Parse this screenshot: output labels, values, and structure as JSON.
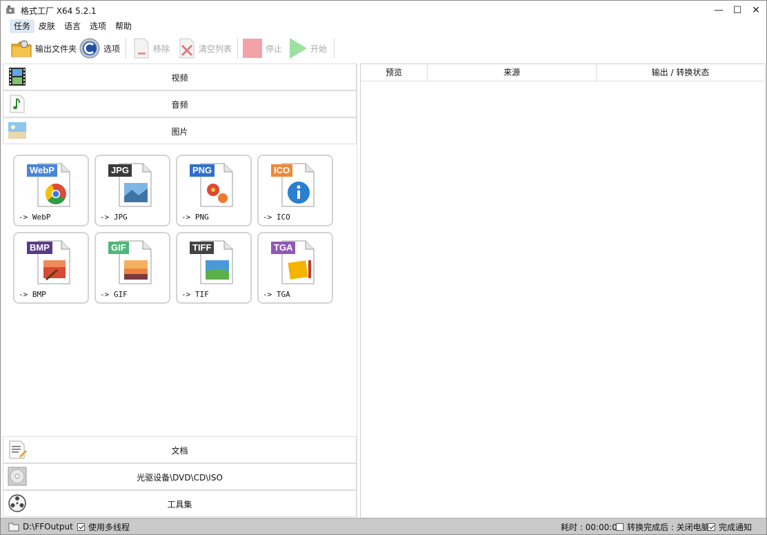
{
  "window": {
    "title": "格式工厂 X64 5.2.1",
    "minimize": "—",
    "maximize": "☐",
    "close": "✕"
  },
  "menu": [
    "任务",
    "皮肤",
    "语言",
    "选项",
    "帮助"
  ],
  "toolbar": {
    "output_folder": "输出文件夹",
    "options": "选项",
    "remove": "移除",
    "clear_list": "清空列表",
    "stop": "停止",
    "start": "开始"
  },
  "categories": {
    "video": "视频",
    "audio": "音频",
    "image": "图片",
    "document": "文档",
    "disc": "光驱设备\\DVD\\CD\\ISO",
    "tools": "工具集"
  },
  "image_formats": [
    {
      "badge": "WebP",
      "label": "-> WebP",
      "color": "#4a86d8"
    },
    {
      "badge": "JPG",
      "label": "-> JPG",
      "color": "#3a3a3a"
    },
    {
      "badge": "PNG",
      "label": "-> PNG",
      "color": "#2f6fce"
    },
    {
      "badge": "ICO",
      "label": "-> ICO",
      "color": "#ee8a3a"
    },
    {
      "badge": "BMP",
      "label": "-> BMP",
      "color": "#5b3a86"
    },
    {
      "badge": "GIF",
      "label": "-> GIF",
      "color": "#4fb87a"
    },
    {
      "badge": "TIFF",
      "label": "-> TIF",
      "color": "#444444"
    },
    {
      "badge": "TGA",
      "label": "-> TGA",
      "color": "#8e58b8"
    }
  ],
  "task_table": {
    "columns": [
      "预览",
      "来源",
      "输出 / 转换状态"
    ]
  },
  "statusbar": {
    "output_path": "D:\\FFOutput",
    "multithread": "使用多线程",
    "elapsed": "耗时 : 00:00:00",
    "after_convert": "转换完成后 : 关闭电脑",
    "notify": "完成通知"
  },
  "colors": {
    "accent": "#4a86d8",
    "statusbar": "#c9c9c9"
  }
}
